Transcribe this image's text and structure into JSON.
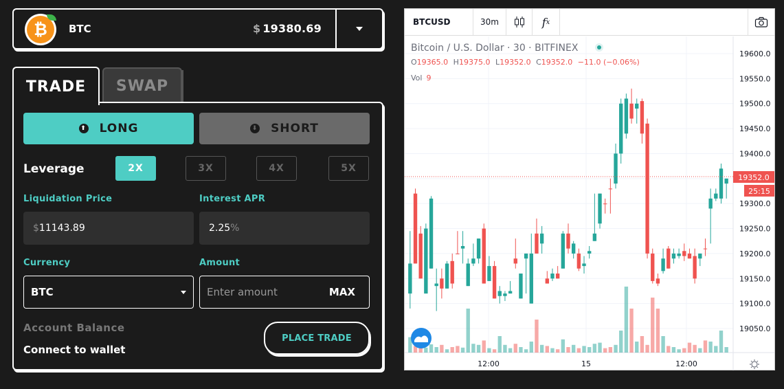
{
  "asset": {
    "coin_glyph": "₿",
    "symbol": "BTC",
    "price_currency": "$",
    "price": "19380.69",
    "dropdown_icon": "chevron-down-icon"
  },
  "tabs": [
    {
      "label": "TRADE",
      "active": true
    },
    {
      "label": "SWAP",
      "active": false
    }
  ],
  "direction": {
    "long": {
      "label": "LONG",
      "icon": "arrow-up-circle-icon",
      "glyph": "⬆",
      "active": true
    },
    "short": {
      "label": "SHORT",
      "icon": "arrow-down-circle-icon",
      "glyph": "⬇",
      "active": false
    }
  },
  "leverage": {
    "label": "Leverage",
    "options": [
      "2X",
      "3X",
      "4X",
      "5X"
    ],
    "selected": "2X"
  },
  "liquidation": {
    "label": "Liquidation Price",
    "currency": "$",
    "value": "11143.89"
  },
  "interest": {
    "label": "Interest APR",
    "value": "2.25",
    "unit": "%"
  },
  "currency": {
    "label": "Currency",
    "selected": "BTC"
  },
  "amount": {
    "label": "Amount",
    "placeholder": "Enter amount",
    "max_label": "MAX"
  },
  "account": {
    "label": "Account Balance",
    "status": "Connect to wallet"
  },
  "place_trade_label": "PLACE TRADE",
  "colors": {
    "accent": "#4ecdc4",
    "up": "#26a69a",
    "down": "#ef5350",
    "background": "#1b1b1b"
  },
  "chart_toolbar": {
    "symbol": "BTCUSD",
    "interval": "30m",
    "fx_label": "f",
    "fx_sub": "x",
    "candle_icon": "candlestick-icon",
    "camera_icon": "camera-icon"
  },
  "chart_legend": {
    "title": "Bitcoin / U.S. Dollar · 30 · BITFINEX",
    "ohlc": [
      {
        "k": "O",
        "v": "19365.0"
      },
      {
        "k": "H",
        "v": "19375.0"
      },
      {
        "k": "L",
        "v": "19352.0"
      },
      {
        "k": "C",
        "v": "19352.0"
      }
    ],
    "change": "−11.0 (−0.06%)",
    "volume_label": "Vol",
    "volume_value": "9"
  },
  "chart_data": {
    "type": "candlestick",
    "y_axis_ticks": [
      "19600.0",
      "19550.0",
      "19500.0",
      "19450.0",
      "19400.0",
      "19350.0",
      "19300.0",
      "19250.0",
      "19200.0",
      "19150.0",
      "19100.0",
      "19050.0"
    ],
    "ylim": [
      19000,
      19620
    ],
    "x_axis_ticks": [
      "12:00",
      "15",
      "12:00"
    ],
    "last_price": "19352.0",
    "countdown": "25:15",
    "candles": [
      [
        19180,
        19245,
        19120,
        19090,
        28,
        1
      ],
      [
        19320,
        19330,
        19180,
        19195,
        12,
        0
      ],
      [
        19240,
        19255,
        19150,
        19155,
        8,
        0
      ],
      [
        19250,
        19260,
        19120,
        19150,
        9,
        1
      ],
      [
        19310,
        19315,
        19170,
        19200,
        15,
        1
      ],
      [
        19135,
        19170,
        19140,
        19085,
        10,
        1
      ],
      [
        19130,
        19170,
        19150,
        19110,
        14,
        0
      ],
      [
        19130,
        19185,
        19180,
        19130,
        6,
        1
      ],
      [
        19185,
        19200,
        19140,
        19130,
        10,
        0
      ],
      [
        19200,
        19245,
        19200,
        19215,
        12,
        0
      ],
      [
        19210,
        19245,
        19215,
        19180,
        9,
        1
      ],
      [
        19180,
        19190,
        19135,
        19160,
        80,
        1
      ],
      [
        19190,
        19220,
        19180,
        19175,
        16,
        1
      ],
      [
        19190,
        19230,
        19230,
        19180,
        14,
        1
      ],
      [
        19250,
        19260,
        19140,
        19150,
        22,
        0
      ],
      [
        19175,
        19195,
        19145,
        19170,
        8,
        1
      ],
      [
        19175,
        19185,
        19110,
        19120,
        6,
        0
      ],
      [
        19125,
        19135,
        19115,
        19100,
        30,
        1
      ],
      [
        19115,
        19125,
        19120,
        19105,
        14,
        1
      ],
      [
        19120,
        19145,
        19125,
        19120,
        8,
        1
      ],
      [
        19180,
        19230,
        19190,
        19170,
        16,
        0
      ],
      [
        19110,
        19130,
        19160,
        19115,
        10,
        1
      ],
      [
        19190,
        19195,
        19200,
        19120,
        6,
        1
      ],
      [
        19200,
        19240,
        19100,
        19110,
        20,
        1
      ],
      [
        19240,
        19270,
        19200,
        19200,
        60,
        0
      ],
      [
        19220,
        19255,
        19240,
        19200,
        14,
        1
      ],
      [
        19150,
        19165,
        19140,
        19140,
        12,
        0
      ],
      [
        19160,
        19170,
        19150,
        19145,
        8,
        1
      ],
      [
        19160,
        19175,
        19150,
        19150,
        6,
        0
      ],
      [
        19170,
        19245,
        19240,
        19170,
        24,
        1
      ],
      [
        19240,
        19260,
        19210,
        19200,
        10,
        0
      ],
      [
        19200,
        19225,
        19220,
        19190,
        14,
        1
      ],
      [
        19200,
        19210,
        19170,
        19165,
        8,
        0
      ],
      [
        19180,
        19195,
        19175,
        19160,
        12,
        1
      ],
      [
        19200,
        19215,
        19205,
        19190,
        10,
        1
      ],
      [
        19240,
        19320,
        19225,
        19230,
        16,
        1
      ],
      [
        19260,
        19320,
        19320,
        19250,
        18,
        1
      ],
      [
        19300,
        19310,
        19300,
        19280,
        8,
        0
      ],
      [
        19330,
        19350,
        19330,
        19280,
        10,
        0
      ],
      [
        19340,
        19420,
        19400,
        19330,
        14,
        1
      ],
      [
        19400,
        19510,
        19500,
        19380,
        40,
        1
      ],
      [
        19440,
        19520,
        19510,
        19430,
        120,
        1
      ],
      [
        19500,
        19530,
        19470,
        19460,
        80,
        0
      ],
      [
        19490,
        19510,
        19500,
        19460,
        20,
        1
      ],
      [
        19505,
        19510,
        19440,
        19420,
        30,
        0
      ],
      [
        19460,
        19470,
        19200,
        19190,
        14,
        0
      ],
      [
        19200,
        19210,
        19145,
        19140,
        100,
        0
      ],
      [
        19150,
        19160,
        19140,
        19135,
        80,
        0
      ],
      [
        19165,
        19210,
        19190,
        19160,
        30,
        1
      ],
      [
        19210,
        19215,
        19170,
        19170,
        12,
        0
      ],
      [
        19190,
        19210,
        19200,
        19180,
        10,
        1
      ],
      [
        19200,
        19210,
        19195,
        19190,
        6,
        1
      ],
      [
        19195,
        19220,
        19205,
        19185,
        8,
        0
      ],
      [
        19200,
        19210,
        19190,
        19190,
        18,
        0
      ],
      [
        19195,
        19210,
        19150,
        19140,
        14,
        0
      ],
      [
        19190,
        19200,
        19200,
        19175,
        8,
        1
      ],
      [
        19210,
        19230,
        19210,
        19195,
        22,
        0
      ],
      [
        19290,
        19330,
        19310,
        19220,
        20,
        1
      ],
      [
        19320,
        19330,
        19310,
        19305,
        12,
        1
      ],
      [
        19370,
        19380,
        19310,
        19300,
        40,
        1
      ],
      [
        19340,
        19350,
        19350,
        19310,
        10,
        1
      ]
    ]
  }
}
